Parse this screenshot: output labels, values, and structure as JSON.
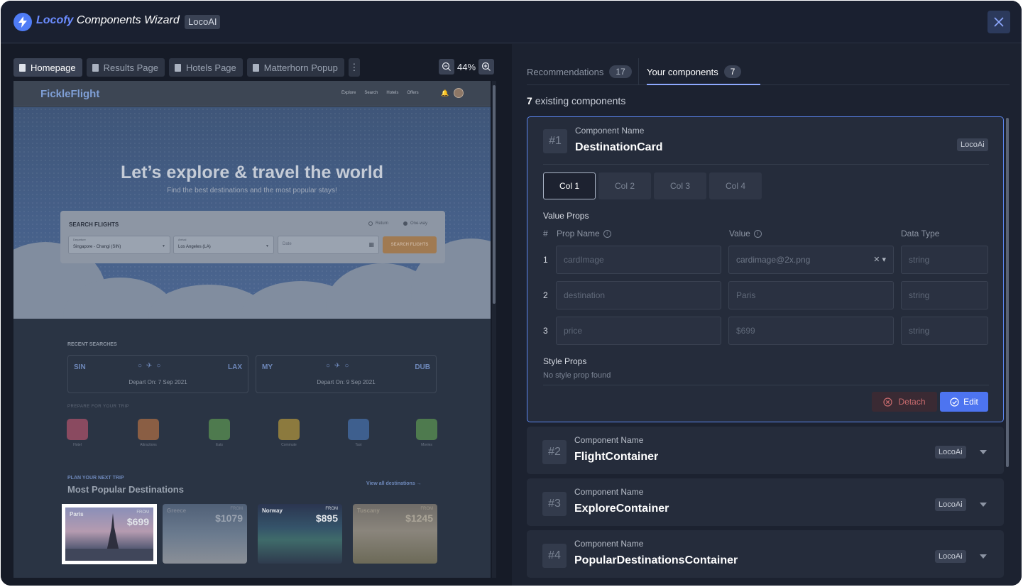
{
  "header": {
    "brand_bold": "Locofy",
    "brand_rest": "Components Wizard",
    "badge": "LocoAI"
  },
  "left_panel": {
    "tabs": [
      {
        "label": "Homepage",
        "active": true
      },
      {
        "label": "Results Page",
        "active": false
      },
      {
        "label": "Hotels Page",
        "active": false
      },
      {
        "label": "Matterhorn Popup",
        "active": false
      }
    ],
    "zoom": "44%",
    "preview": {
      "logo": "FickleFlight",
      "nav_links": [
        "Explore",
        "Search",
        "Hotels",
        "Offers"
      ],
      "hero_title": "Let’s explore & travel the world",
      "hero_subtitle": "Find the best destinations and the most popular stays!",
      "search": {
        "title": "SEARCH FLIGHTS",
        "radio_return": "Return",
        "radio_oneway": "One-way",
        "departure_label": "Departure",
        "departure_value": "Singapore - Changi (SIN)",
        "arrival_label": "Arrival",
        "arrival_value": "Los Angeles (LA)",
        "date_placeholder": "Date",
        "button": "SEARCH FLIGHTS"
      },
      "recent_label": "RECENT SEARCHES",
      "recent": [
        {
          "from": "SIN",
          "to": "LAX",
          "depart": "Depart On: 7 Sep 2021"
        },
        {
          "from": "MY",
          "to": "DUB",
          "depart": "Depart On: 9 Sep 2021"
        }
      ],
      "prepare_label": "PREPARE FOR YOUR TRIP",
      "categories": [
        {
          "name": "Hotel",
          "color": "#8a4a60"
        },
        {
          "name": "Attractions",
          "color": "#8a5e44"
        },
        {
          "name": "Eats",
          "color": "#4e7a4e"
        },
        {
          "name": "Commute",
          "color": "#8c7a3e"
        },
        {
          "name": "Taxi",
          "color": "#3e5f8e"
        },
        {
          "name": "Movies",
          "color": "#4e7a4e"
        }
      ],
      "plan_label": "PLAN YOUR NEXT TRIP",
      "popular_title": "Most Popular Destinations",
      "view_all": "View all destinations →",
      "destinations": [
        {
          "name": "Paris",
          "from": "FROM",
          "price": "$699"
        },
        {
          "name": "Greece",
          "from": "FROM",
          "price": "$1079"
        },
        {
          "name": "Norway",
          "from": "FROM",
          "price": "$895"
        },
        {
          "name": "Tuscany",
          "from": "FROM",
          "price": "$1245"
        }
      ]
    }
  },
  "right_panel": {
    "tabs": [
      {
        "label": "Recommendations",
        "count": "17"
      },
      {
        "label": "Your components",
        "count": "7"
      }
    ],
    "existing_count": "7",
    "existing_text": "existing components",
    "component_name_label": "Component Name",
    "loco_badge": "LocoAi",
    "components": [
      {
        "num": "#1",
        "name": "DestinationCard"
      },
      {
        "num": "#2",
        "name": "FlightContainer"
      },
      {
        "num": "#3",
        "name": "ExploreContainer"
      },
      {
        "num": "#4",
        "name": "PopularDestinationsContainer"
      }
    ],
    "col_tabs": [
      "Col 1",
      "Col 2",
      "Col 3",
      "Col 4"
    ],
    "value_props_title": "Value Props",
    "headers": {
      "num": "#",
      "prop": "Prop Name",
      "value": "Value",
      "type": "Data Type"
    },
    "props": [
      {
        "n": "1",
        "name": "cardImage",
        "value": "cardimage@2x.png",
        "type": "string"
      },
      {
        "n": "2",
        "name": "destination",
        "value": "Paris",
        "type": "string"
      },
      {
        "n": "3",
        "name": "price",
        "value": "$699",
        "type": "string"
      }
    ],
    "style_props_title": "Style Props",
    "no_style": "No style prop found",
    "detach_label": "Detach",
    "edit_label": "Edit"
  }
}
